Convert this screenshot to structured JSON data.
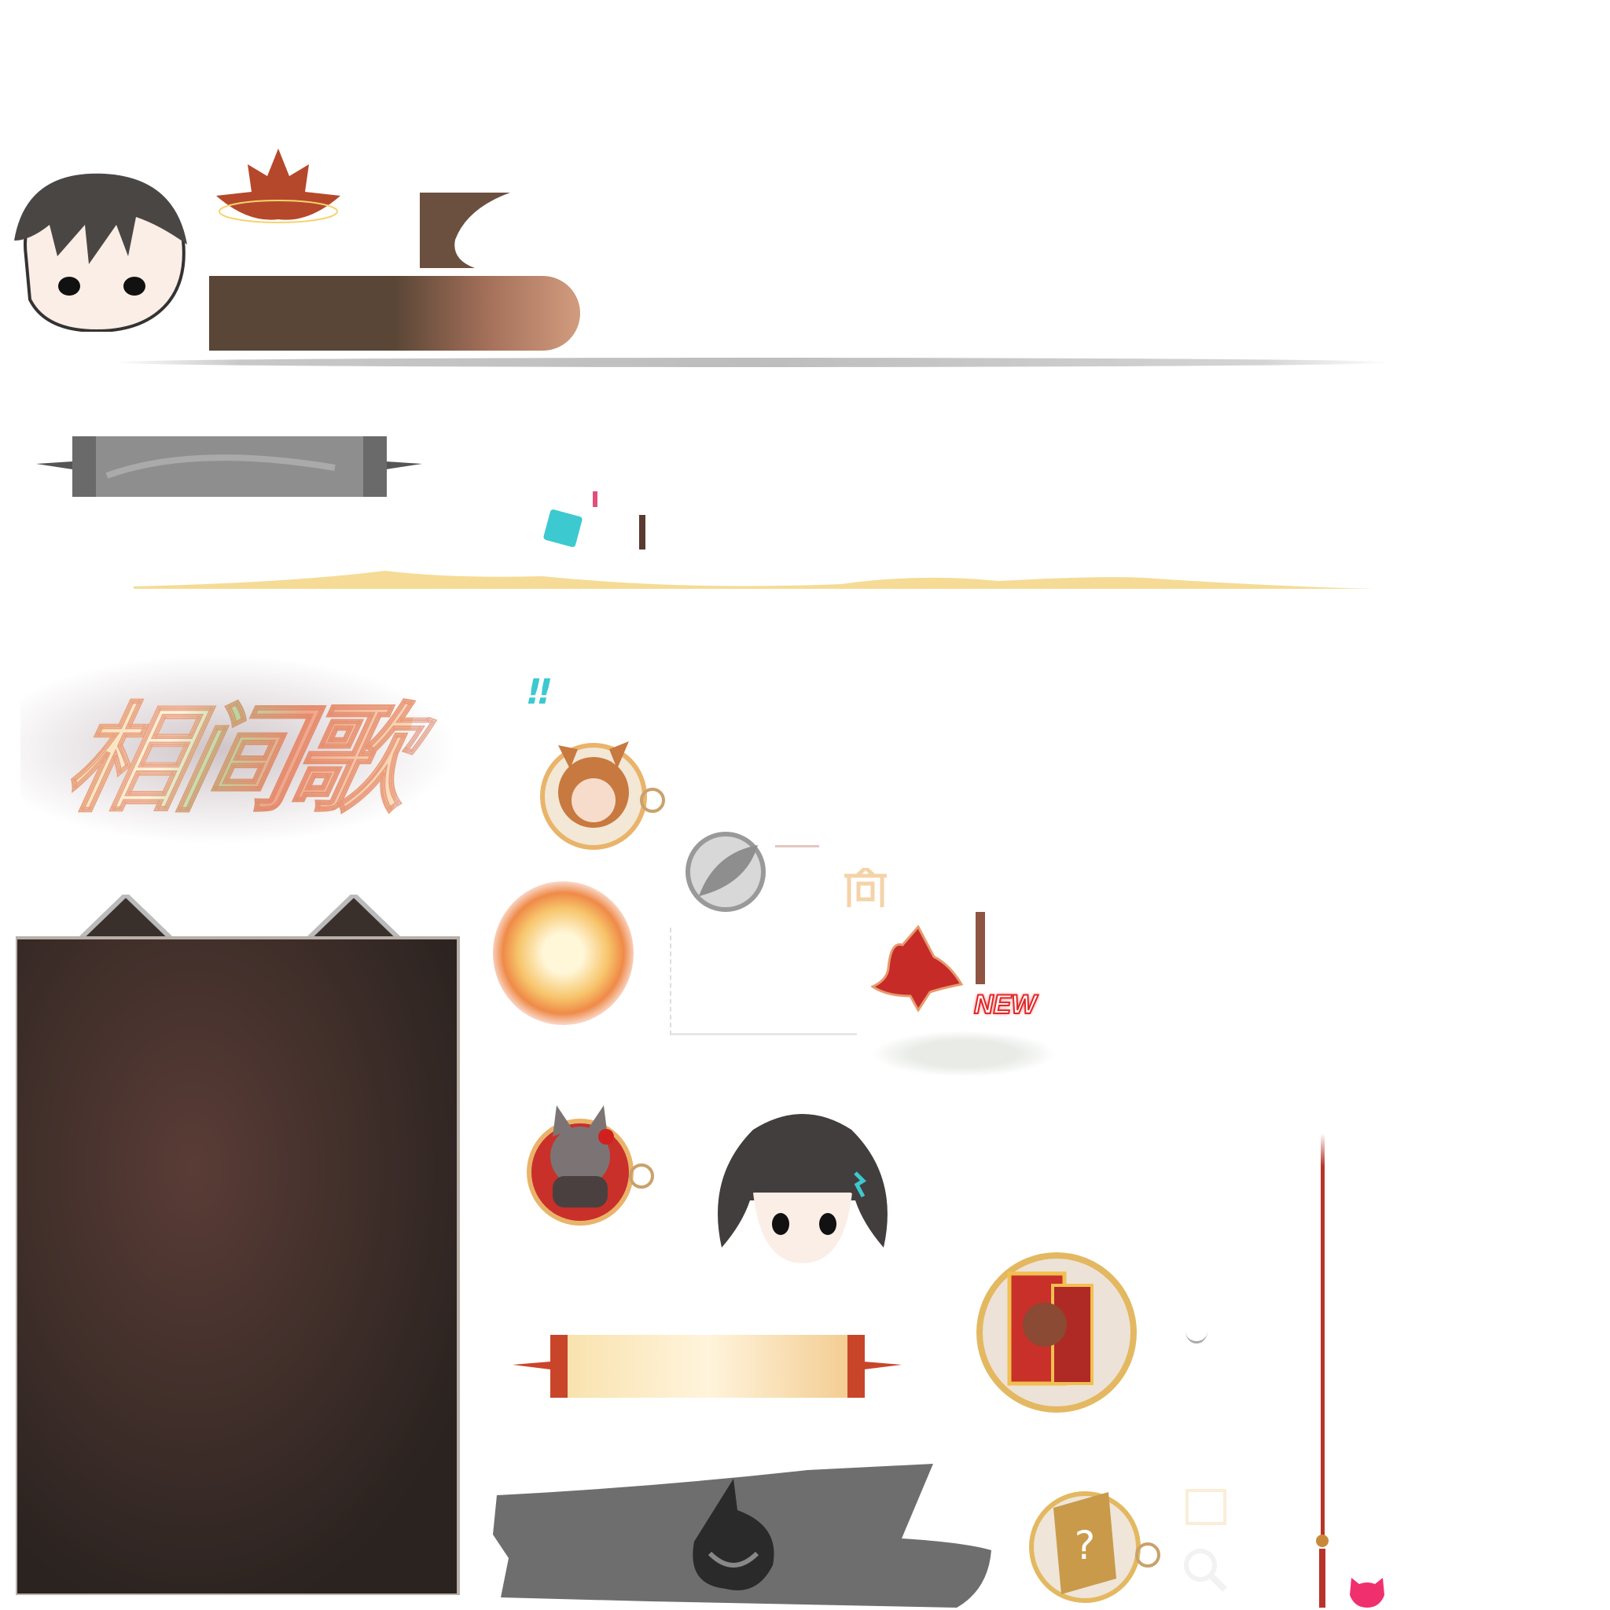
{
  "logo": {
    "text": "相间歌"
  },
  "badge": {
    "new_label": "NEW"
  },
  "colors": {
    "brown_dark": "#5a4636",
    "brown_light": "#c98e70",
    "maple_red": "#c9302a",
    "gold": "#f3cf6f",
    "gray_banner": "#8c8c8c",
    "panel_dark": "#2e2520",
    "string_red": "#b8342a",
    "pink": "#f0306e"
  }
}
